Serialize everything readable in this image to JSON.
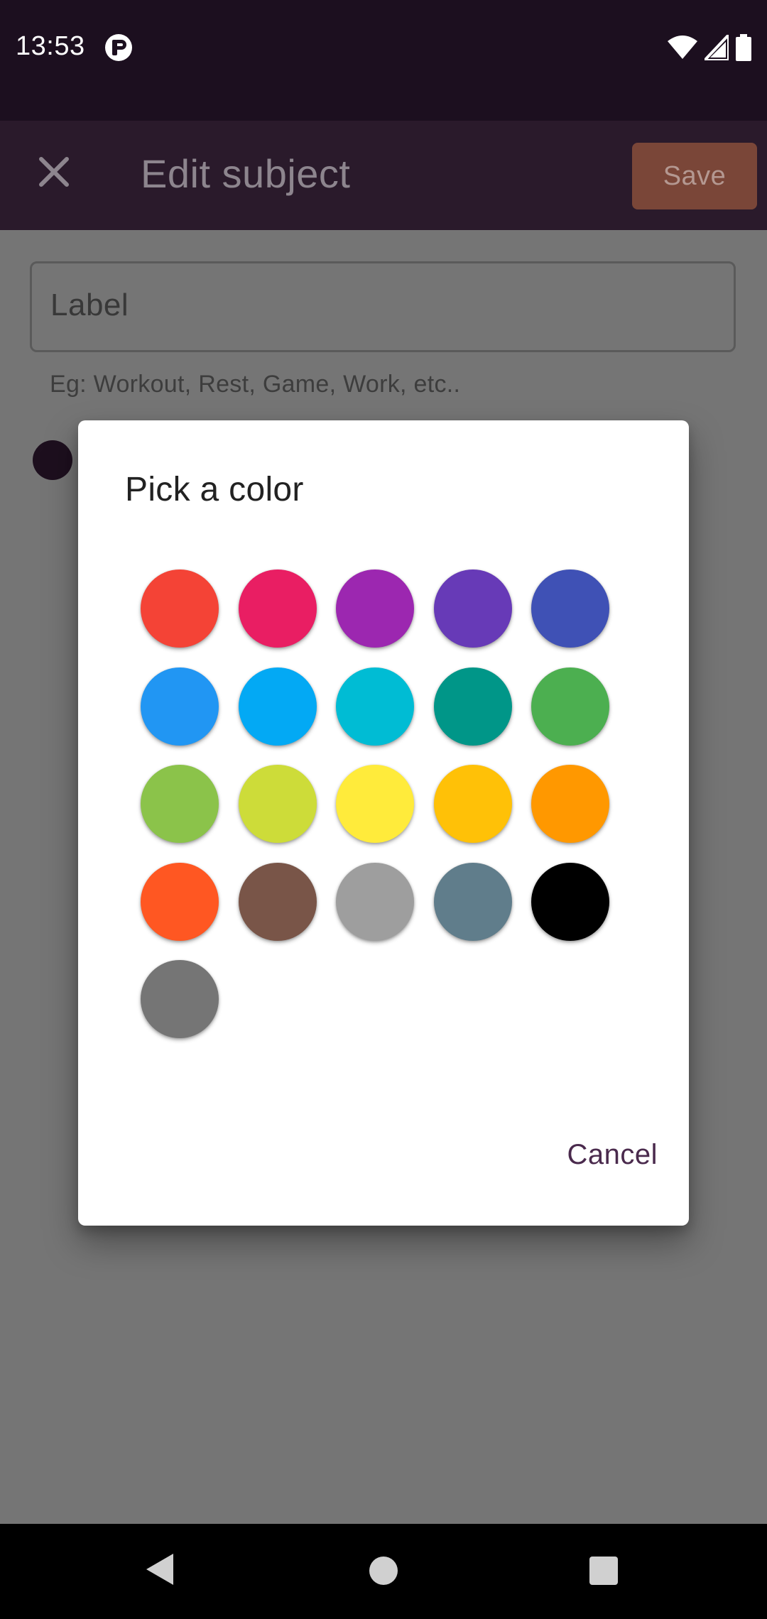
{
  "status_bar": {
    "time": "13:53",
    "icons": [
      "app-notification-icon",
      "wifi-icon",
      "cellular-signal-icon",
      "battery-icon"
    ]
  },
  "app_bar": {
    "close_icon": "close-icon",
    "title": "Edit subject",
    "save_label": "Save"
  },
  "form": {
    "label_placeholder": "Label",
    "helper_text": "Eg: Workout, Rest, Game, Work, etc..",
    "selected_color": "#1d0f1e"
  },
  "dialog": {
    "title": "Pick a color",
    "colors": [
      "#f44336",
      "#e91e63",
      "#9c27b0",
      "#673ab7",
      "#3f51b5",
      "#2196f3",
      "#03a9f4",
      "#00bcd4",
      "#009688",
      "#4caf50",
      "#8bc34a",
      "#cddc39",
      "#ffeb3b",
      "#ffc107",
      "#ff9800",
      "#ff5722",
      "#795548",
      "#9e9e9e",
      "#607d8b",
      "#000000",
      "#757575"
    ],
    "cancel_label": "Cancel"
  },
  "nav_bar": {
    "icons": [
      "back-icon",
      "home-icon",
      "recents-icon"
    ]
  }
}
